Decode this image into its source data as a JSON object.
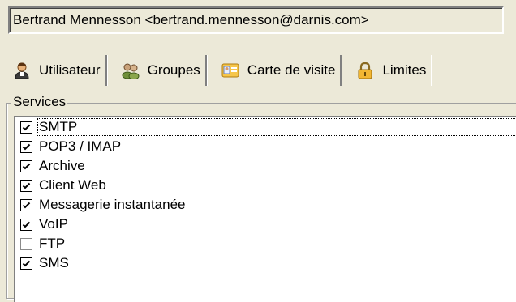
{
  "user": {
    "display": "Bertrand Mennesson <bertrand.mennesson@darnis.com>"
  },
  "tabs": [
    {
      "label": "Utilisateur",
      "icon": "user-icon"
    },
    {
      "label": "Groupes",
      "icon": "groups-icon"
    },
    {
      "label": "Carte de visite",
      "icon": "business-card-icon"
    },
    {
      "label": "Limites",
      "icon": "lock-icon"
    }
  ],
  "services": {
    "title": "Services",
    "items": [
      {
        "label": "SMTP",
        "checked": true
      },
      {
        "label": "POP3 / IMAP",
        "checked": true
      },
      {
        "label": "Archive",
        "checked": true
      },
      {
        "label": "Client Web",
        "checked": true
      },
      {
        "label": "Messagerie instantanée",
        "checked": true
      },
      {
        "label": "VoIP",
        "checked": true
      },
      {
        "label": "FTP",
        "checked": false
      },
      {
        "label": "SMS",
        "checked": true
      }
    ]
  }
}
